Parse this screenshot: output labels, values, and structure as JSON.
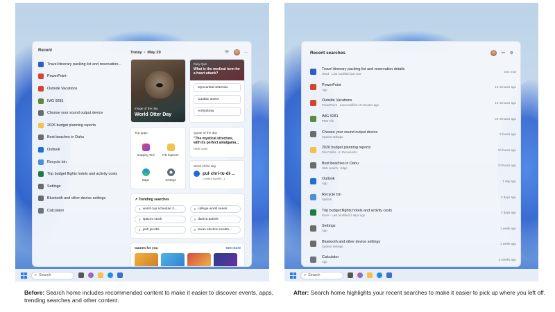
{
  "before": {
    "panel": {
      "recent_title": "Recent",
      "recent_items": [
        {
          "label": "Travel itinerary packing list and reservation...",
          "icon": "word-doc-icon",
          "color": "#2b5fc4"
        },
        {
          "label": "PowerPoint",
          "icon": "powerpoint-icon",
          "color": "#d2472b"
        },
        {
          "label": "Outside Vacations",
          "icon": "powerpoint-icon",
          "color": "#d2472b"
        },
        {
          "label": "IMG 9281",
          "icon": "image-thumbnail-icon",
          "color": "#5b8a3a"
        },
        {
          "label": "Choose your sound output device",
          "icon": "speaker-icon",
          "color": "#6b6b6b"
        },
        {
          "label": "2026 budget planning reports",
          "icon": "folder-icon",
          "color": "#f2c14e"
        },
        {
          "label": "Best beaches in Oahu",
          "icon": "search-icon",
          "color": "#6b6b6b"
        },
        {
          "label": "Outlook",
          "icon": "outlook-icon",
          "color": "#1f6dd8"
        },
        {
          "label": "Recycle bin",
          "icon": "recycle-bin-icon",
          "color": "#4d8fd8"
        },
        {
          "label": "Trip budget flights hotels and activity costs",
          "icon": "excel-icon",
          "color": "#1e7a45"
        },
        {
          "label": "Settings",
          "icon": "gear-icon",
          "color": "#6b6b6b"
        },
        {
          "label": "Bluetooth and other device settings",
          "icon": "bluetooth-icon",
          "color": "#6b6b6b"
        },
        {
          "label": "Calculator",
          "icon": "calculator-icon",
          "color": "#6b7280"
        }
      ],
      "date_label": "Today",
      "date_value": "May 29",
      "image_of_day": {
        "kicker": "Image of the day",
        "title": "World Otter Day"
      },
      "quiz": {
        "kicker": "Daily Quiz",
        "question": "What is the medical term for a heart attack?",
        "options": [
          "Myocardial infarction",
          "Cardiac arrest",
          "Arrhythmia"
        ]
      },
      "top_apps": {
        "title": "Top apps",
        "apps": [
          {
            "label": "Snipping Tool",
            "color": "#e0446c"
          },
          {
            "label": "File Explorer",
            "color": "#f2c14e"
          },
          {
            "label": "Edge",
            "color": "#1f8de0"
          },
          {
            "label": "Settings",
            "color": "#5a6b7c"
          }
        ]
      },
      "quote": {
        "title": "Quote of the day",
        "text": "\"The mystical structure, with its perfect amalgama...",
        "author": "Herb Caen"
      },
      "word": {
        "title": "Word of the day",
        "word": "pul·chri·tu·di·...",
        "sub": "(ˌpəlkrəˈt(y)o͞od...)"
      },
      "trending": {
        "title": "Trending searches",
        "items": [
          "world cup schedule 2...",
          "college world series",
          "spacex stock",
          "danica patrick",
          "josh jacobs",
          "texas election results..."
        ]
      },
      "games": {
        "title": "Games for you",
        "more": "See more"
      }
    },
    "taskbar": {
      "search_placeholder": "Search"
    },
    "caption_bold": "Before:",
    "caption_text": " Search home includes recommended content to make it easier to discover events, apps, trending searches and other content."
  },
  "after": {
    "panel": {
      "title": "Recent searches",
      "items": [
        {
          "name": "Travel itinerary packing list and reservation details",
          "sub": "Word · Last modified just now",
          "time": "Just now",
          "icon": "word-doc-icon",
          "color": "#2b5fc4"
        },
        {
          "name": "PowerPoint",
          "sub": "App",
          "time": "10 minutes ago",
          "icon": "powerpoint-icon",
          "color": "#d2472b"
        },
        {
          "name": "Outside Vacations",
          "sub": "PowerPoint · Last modified 10 minutes ago",
          "time": "10 minutes ago",
          "icon": "powerpoint-icon",
          "color": "#d2472b"
        },
        {
          "name": "IMG 9281",
          "sub": "PNG File",
          "time": "20 minutes ago",
          "icon": "image-thumbnail-icon",
          "color": "#5b8a3a"
        },
        {
          "name": "Choose your sound output device",
          "sub": "System settings",
          "time": "5 hours ago",
          "icon": "speaker-icon",
          "color": "#6b6b6b"
        },
        {
          "name": "2026 budget planning reports",
          "sub": "File Folder · In Documents",
          "time": "10 hours ago",
          "icon": "folder-icon",
          "color": "#f2c14e"
        },
        {
          "name": "Best beaches in Oahu",
          "sub": "Web search · Edge",
          "time": "10 hours ago",
          "icon": "search-icon",
          "color": "#6b6b6b"
        },
        {
          "name": "Outlook",
          "sub": "App",
          "time": "1 day ago",
          "icon": "outlook-icon",
          "color": "#1f6dd8"
        },
        {
          "name": "Recycle bin",
          "sub": "System",
          "time": "2 days ago",
          "icon": "recycle-bin-icon",
          "color": "#4d8fd8"
        },
        {
          "name": "Trip budget flights hotels and activity costs",
          "sub": "Excel · Last modified 2 days ago",
          "time": "2 days ago",
          "icon": "excel-icon",
          "color": "#1e7a45"
        },
        {
          "name": "Settings",
          "sub": "App",
          "time": "1 week ago",
          "icon": "gear-icon",
          "color": "#6b6b6b"
        },
        {
          "name": "Bluetooth and other device settings",
          "sub": "System settings",
          "time": "1 week ago",
          "icon": "bluetooth-icon",
          "color": "#6b6b6b"
        },
        {
          "name": "Calculator",
          "sub": "App",
          "time": "2 weeks ago",
          "icon": "calculator-icon",
          "color": "#6b7280"
        }
      ]
    },
    "taskbar": {
      "search_placeholder": "Search"
    },
    "caption_bold": "After:",
    "caption_text": " Search home highlights your recent searches to make it easier to pick up where you left off."
  }
}
